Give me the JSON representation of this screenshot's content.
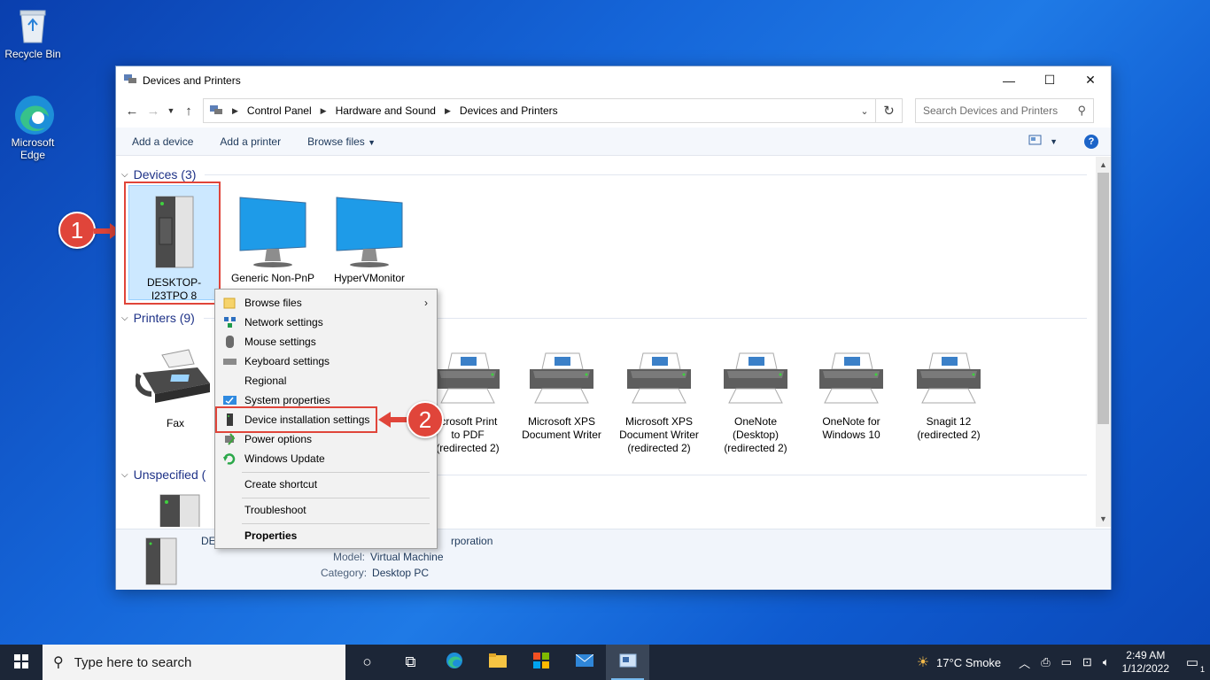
{
  "desktop": {
    "icons": [
      {
        "label": "Recycle Bin",
        "icon": "recycle-bin-icon"
      },
      {
        "label": "Microsoft Edge",
        "icon": "edge-icon"
      }
    ]
  },
  "window": {
    "title": "Devices and Printers",
    "controls": {
      "minimize": "—",
      "maximize": "☐",
      "close": "✕"
    }
  },
  "address": {
    "crumbs": [
      "Control Panel",
      "Hardware and Sound",
      "Devices and Printers"
    ],
    "search_placeholder": "Search Devices and Printers"
  },
  "commands": {
    "add_device": "Add a device",
    "add_printer": "Add a printer",
    "browse_files": "Browse files"
  },
  "groups": {
    "devices": "Devices (3)",
    "printers": "Printers (9)",
    "unspecified": "Unspecified ("
  },
  "devices": [
    {
      "label": "DESKTOP-I23TPO 8",
      "icon": "desktop-tower-icon"
    },
    {
      "label": "Generic Non-PnP",
      "icon": "monitor-icon"
    },
    {
      "label": "HyperVMonitor",
      "icon": "monitor-icon"
    }
  ],
  "printers": [
    {
      "label": "Fax",
      "icon": "fax-icon"
    },
    {
      "label": "icrosoft Print to PDF (redirected 2)",
      "icon": "printer-icon"
    },
    {
      "label": "Microsoft XPS Document Writer",
      "icon": "printer-icon"
    },
    {
      "label": "Microsoft XPS Document Writer (redirected 2)",
      "icon": "printer-icon"
    },
    {
      "label": "OneNote (Desktop) (redirected 2)",
      "icon": "printer-icon"
    },
    {
      "label": "OneNote for Windows 10",
      "icon": "printer-icon"
    },
    {
      "label": "Snagit 12 (redirected 2)",
      "icon": "printer-icon"
    }
  ],
  "details": {
    "name_partial": "DE",
    "manufacturer_partial": "rporation",
    "model_label": "Model:",
    "model_value": "Virtual Machine",
    "category_label": "Category:",
    "category_value": "Desktop PC"
  },
  "context_menu": {
    "items": [
      {
        "label": "Browse files",
        "icon": "folder-icon",
        "submenu": true
      },
      {
        "label": "Network settings",
        "icon": "network-icon"
      },
      {
        "label": "Mouse settings",
        "icon": "mouse-icon"
      },
      {
        "label": "Keyboard settings",
        "icon": "keyboard-icon"
      },
      {
        "label": "Regional",
        "icon": ""
      },
      {
        "label": "System properties",
        "icon": "system-icon"
      },
      {
        "label": "Device installation settings",
        "icon": "device-icon"
      },
      {
        "label": "Power options",
        "icon": "power-icon"
      },
      {
        "label": "Windows Update",
        "icon": "update-icon"
      },
      {
        "label": "Create shortcut",
        "icon": ""
      },
      {
        "label": "Troubleshoot",
        "icon": ""
      },
      {
        "label": "Properties",
        "icon": ""
      }
    ]
  },
  "annotations": {
    "step1": "1",
    "step2": "2"
  },
  "taskbar": {
    "search_placeholder": "Type here to search",
    "weather": "17°C  Smoke",
    "time": "2:49 AM",
    "date": "1/12/2022",
    "notifications": "1"
  },
  "colors": {
    "annotation_red": "#e0453a",
    "group_header": "#1e3287",
    "selection": "#cce8ff"
  }
}
